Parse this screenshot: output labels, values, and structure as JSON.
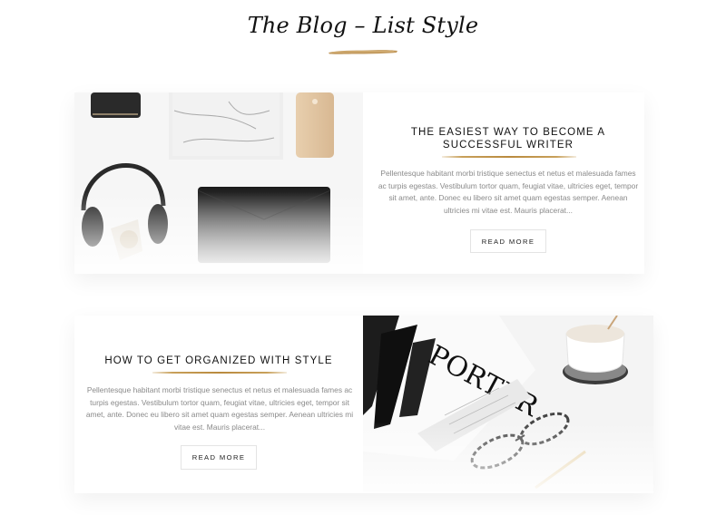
{
  "header": {
    "title": "The Blog – List Style"
  },
  "posts": [
    {
      "title": "THE EASIEST WAY TO BECOME A SUCCESSFUL WRITER",
      "excerpt": "Pellentesque habitant morbi tristique senectus et netus et malesuada fames ac turpis egestas. Vestibulum tortor quam, feugiat vitae, ultricies eget, tempor sit amet, ante. Donec eu libero sit amet quam egestas semper. Aenean ultricies mi vitae est. Mauris placerat...",
      "button": "READ MORE"
    },
    {
      "title": "HOW TO GET ORGANIZED WITH STYLE",
      "excerpt": "Pellentesque habitant morbi tristique senectus et netus et malesuada fames ac turpis egestas. Vestibulum tortor quam, feugiat vitae, ultricies eget, tempor sit amet, ante. Donec eu libero sit amet quam egestas semper. Aenean ultricies mi vitae est. Mauris placerat...",
      "button": "READ MORE"
    }
  ],
  "colors": {
    "accent_gold": "#c8a05a",
    "text_muted": "#8a8a8a",
    "text_dark": "#111111"
  },
  "icons": [
    "brush-stroke-divider",
    "gold-underline"
  ]
}
